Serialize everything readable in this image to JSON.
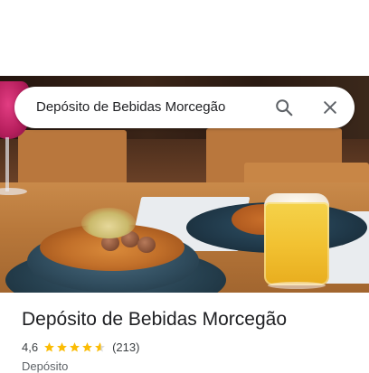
{
  "search": {
    "query": "Depósito de Bebidas Morcegão",
    "search_icon": "search-icon",
    "close_icon": "close-icon"
  },
  "place": {
    "name": "Depósito de Bebidas Morcegão",
    "rating": "4,6",
    "rating_value": 4.6,
    "review_count": "(213)",
    "category": "Depósito"
  },
  "colors": {
    "star": "#fbbc04",
    "text_primary": "#202124",
    "text_secondary": "#5f6368"
  }
}
